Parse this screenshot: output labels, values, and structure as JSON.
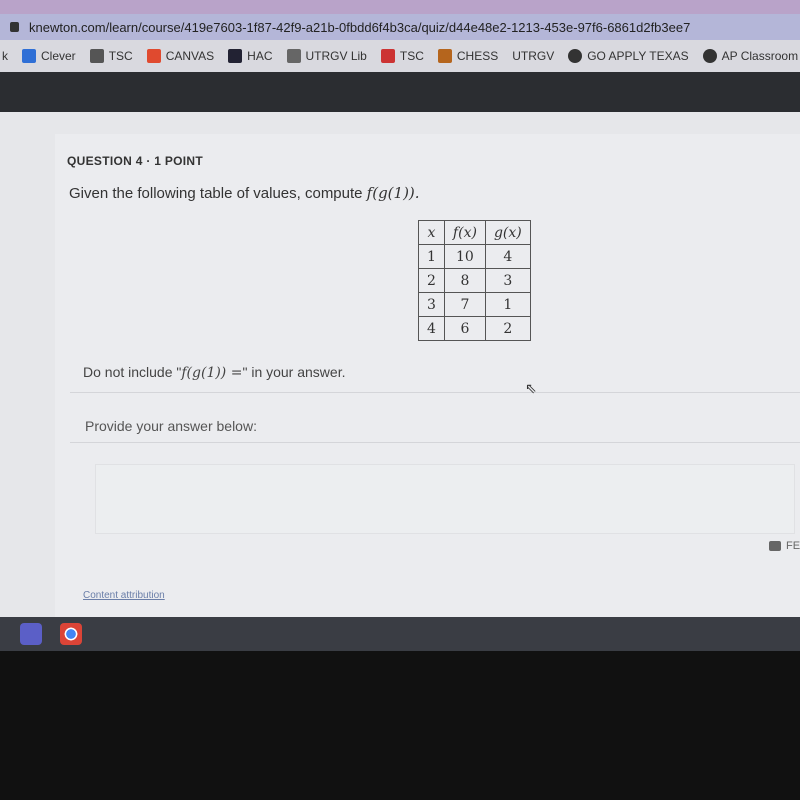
{
  "browser": {
    "url": "knewton.com/learn/course/419e7603-1f87-42f9-a21b-0fbdd6f4b3ca/quiz/d44e48e2-1213-453e-97f6-6861d2fb3ee7",
    "bookmarks": [
      {
        "label": "k",
        "icon": ""
      },
      {
        "label": "Clever",
        "icon": "clever-icon"
      },
      {
        "label": "TSC",
        "icon": "tsc-icon"
      },
      {
        "label": "CANVAS",
        "icon": "canvas-icon"
      },
      {
        "label": "HAC",
        "icon": "hac-icon"
      },
      {
        "label": "UTRGV Lib",
        "icon": "library-icon"
      },
      {
        "label": "TSC",
        "icon": "tsc-lobster-icon"
      },
      {
        "label": "CHESS",
        "icon": "chess-pawn-icon"
      },
      {
        "label": "UTRGV",
        "icon": ""
      },
      {
        "label": "GO APPLY TEXAS",
        "icon": "globe-icon"
      },
      {
        "label": "AP Classroom",
        "icon": "globe-icon"
      }
    ]
  },
  "question": {
    "header": "QUESTION 4 · 1 POINT",
    "prompt": "Given the following table of values, compute ",
    "prompt_math": "f(g(1)).",
    "table": {
      "headers": [
        "x",
        "f(x)",
        "g(x)"
      ],
      "rows": [
        [
          "1",
          "10",
          "4"
        ],
        [
          "2",
          "8",
          "3"
        ],
        [
          "3",
          "7",
          "1"
        ],
        [
          "4",
          "6",
          "2"
        ]
      ]
    },
    "note_before": "Do not include \"",
    "note_math": "f(g(1)) =",
    "note_after": "\" in your answer.",
    "answer_prompt": "Provide your answer below:",
    "answer_value": "",
    "feedback_label": "FE",
    "attribution": "Content attribution"
  },
  "taskbar": {
    "apps": [
      "teams-icon",
      "chrome-icon"
    ]
  }
}
